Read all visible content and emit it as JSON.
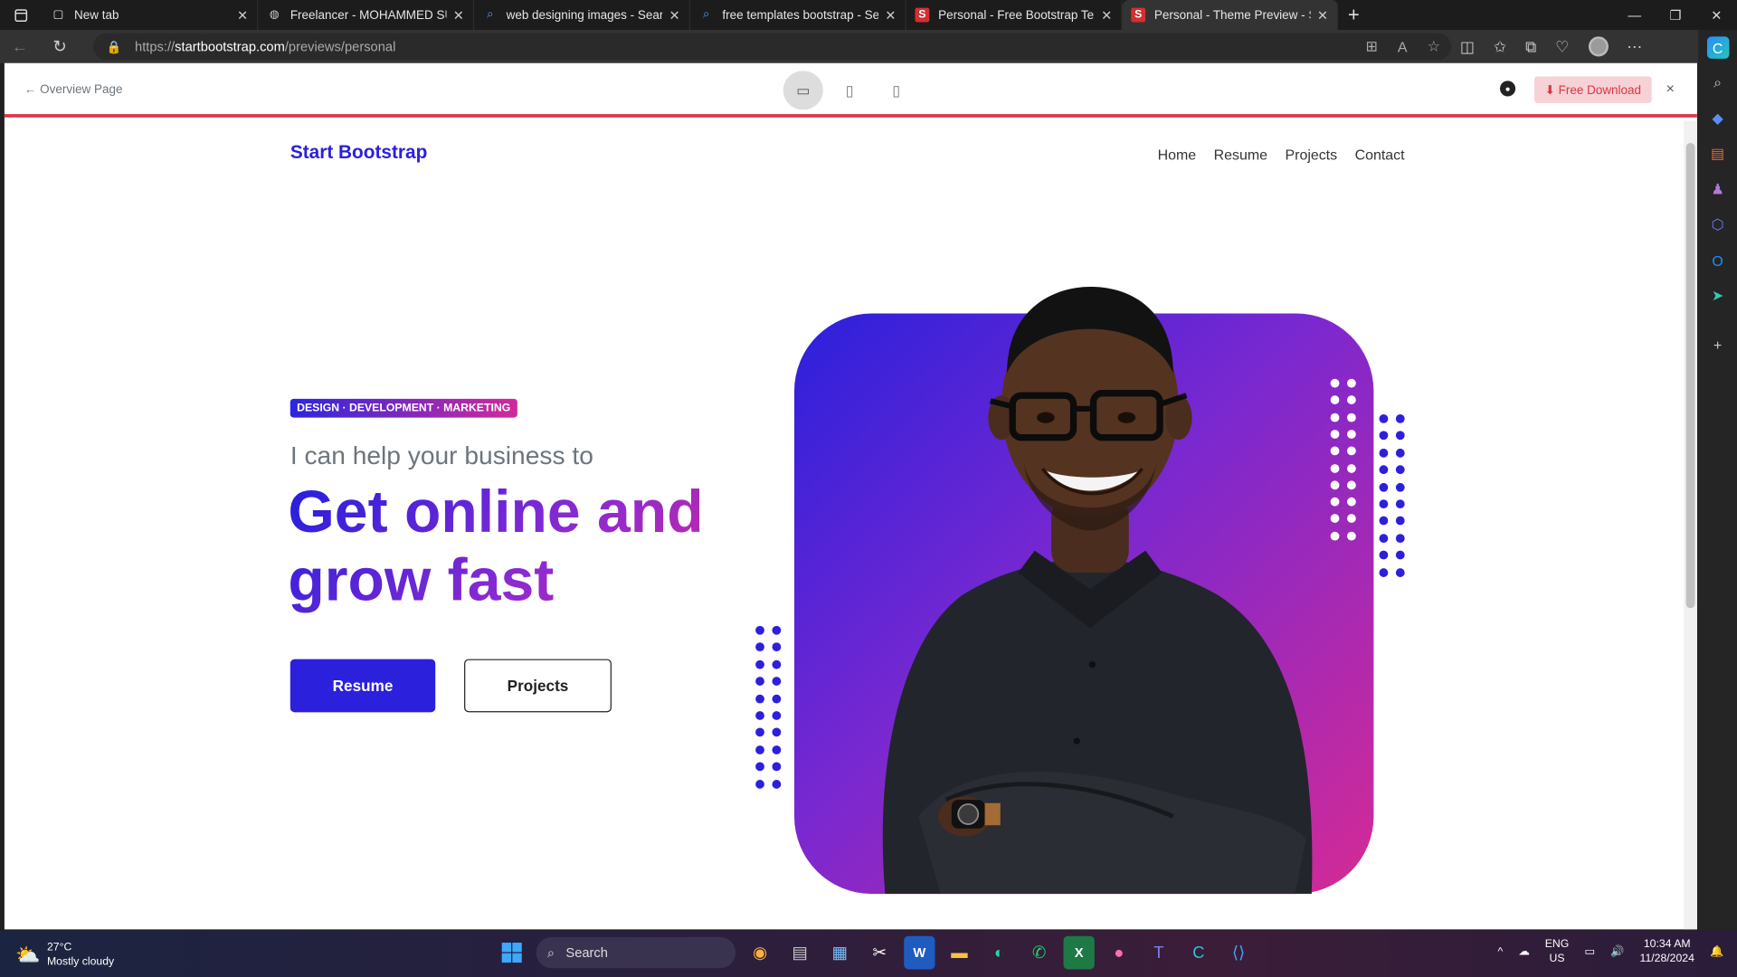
{
  "browser": {
    "tabs": [
      {
        "title": "New tab",
        "icon": "newtab-icon"
      },
      {
        "title": "Freelancer - MOHAMMED SUHAIL",
        "icon": "globe-icon"
      },
      {
        "title": "web designing images - Search",
        "icon": "search-icon"
      },
      {
        "title": "free templates bootstrap - Search",
        "icon": "search-icon"
      },
      {
        "title": "Personal - Free Bootstrap Template",
        "icon": "startbootstrap-icon"
      },
      {
        "title": "Personal - Theme Preview - Start",
        "icon": "startbootstrap-icon"
      }
    ],
    "url_prefix": "https://",
    "url_domain": "startbootstrap.com",
    "url_path": "/previews/personal"
  },
  "preview": {
    "overview_label": "← Overview Page",
    "download_label": "⬇ Free Download",
    "close_label": "×"
  },
  "site": {
    "brand": "Start Bootstrap",
    "nav": [
      "Home",
      "Resume",
      "Projects",
      "Contact"
    ],
    "badge": "DESIGN · DEVELOPMENT · MARKETING",
    "lead": "I can help your business to",
    "headline": "Get online and grow fast",
    "primary_button": "Resume",
    "secondary_button": "Projects"
  },
  "taskbar": {
    "temperature": "27°C",
    "weather": "Mostly cloudy",
    "search_label": "Search",
    "language_top": "ENG",
    "language_bottom": "US",
    "time": "10:34 AM",
    "date": "11/28/2024"
  },
  "colors": {
    "brand": "#2b20dc",
    "accent_pink": "#d52a95",
    "danger": "#dc3545"
  }
}
